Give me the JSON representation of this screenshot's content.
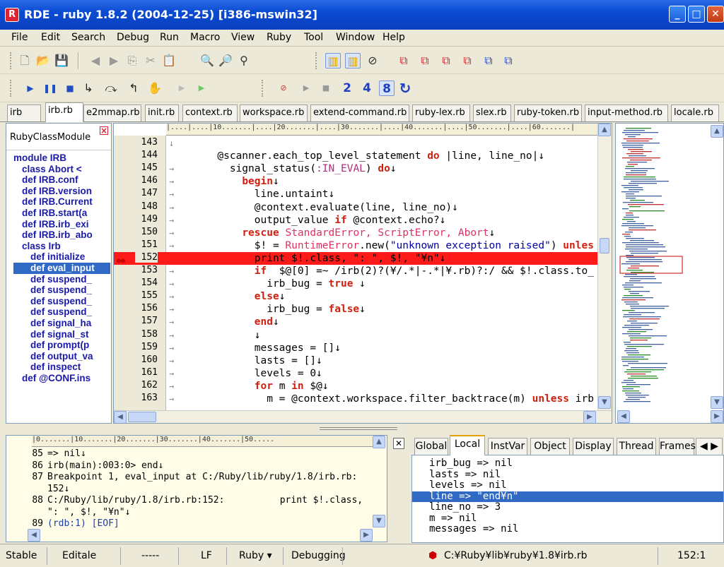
{
  "window": {
    "title": "RDE - ruby 1.8.2 (2004-12-25) [i386-mswin32]",
    "app_icon": "R"
  },
  "menu": [
    "File",
    "Edit",
    "Search",
    "Debug",
    "Run",
    "Macro",
    "View",
    "Ruby",
    "Tool",
    "Window",
    "Help"
  ],
  "toolbar2": {
    "speed_values": [
      "2",
      "4",
      "8"
    ]
  },
  "file_tabs": [
    "irb",
    "irb.rb",
    "e2mmap.rb",
    "init.rb",
    "context.rb",
    "workspace.rb",
    "extend-command.rb",
    "ruby-lex.rb",
    "slex.rb",
    "ruby-token.rb",
    "input-method.rb",
    "locale.rb"
  ],
  "left_panel": {
    "title": "RubyClassModule",
    "items": [
      {
        "text": "module IRB",
        "indent": 0
      },
      {
        "text": "class Abort <",
        "indent": 1
      },
      {
        "text": "def IRB.conf",
        "indent": 1
      },
      {
        "text": "def IRB.version",
        "indent": 1
      },
      {
        "text": "def IRB.Current",
        "indent": 1
      },
      {
        "text": "def IRB.start(a",
        "indent": 1
      },
      {
        "text": "def IRB.irb_exi",
        "indent": 1
      },
      {
        "text": "def IRB.irb_abo",
        "indent": 1
      },
      {
        "text": "class Irb",
        "indent": 1
      },
      {
        "text": "def initialize",
        "indent": 2
      },
      {
        "text": "def eval_input",
        "indent": 2,
        "selected": true
      },
      {
        "text": "def suspend_",
        "indent": 2
      },
      {
        "text": "def suspend_",
        "indent": 2
      },
      {
        "text": "def suspend_",
        "indent": 2
      },
      {
        "text": "def suspend_",
        "indent": 2
      },
      {
        "text": "def signal_ha",
        "indent": 2
      },
      {
        "text": "def signal_st",
        "indent": 2
      },
      {
        "text": "def prompt(p",
        "indent": 2
      },
      {
        "text": "def output_va",
        "indent": 2
      },
      {
        "text": "def inspect",
        "indent": 2
      },
      {
        "text": "def @CONF.ins",
        "indent": 1
      }
    ]
  },
  "editor": {
    "ruler": "|....|....|10.......|....|20.......|....|30.......|....|40.......|....|50.......|....|60.......|",
    "lines": [
      {
        "n": "143",
        "arrow": "↓",
        "html": ""
      },
      {
        "n": "144",
        "arrow": "",
        "html": "      @scanner.each_top_level_statement <span class=\"kw\">do</span> |line, line_no|↓"
      },
      {
        "n": "145",
        "arrow": "→",
        "html": "        signal_status(<span class=\"sy\">:IN_EVAL</span>) <span class=\"kw\">do</span>↓"
      },
      {
        "n": "146",
        "arrow": "→",
        "html": "          <span class=\"kw\">begin</span>↓"
      },
      {
        "n": "147",
        "arrow": "→",
        "html": "            line.untaint↓"
      },
      {
        "n": "148",
        "arrow": "→",
        "html": "            @context.evaluate(line, line_no)↓"
      },
      {
        "n": "149",
        "arrow": "→",
        "html": "            output_value <span class=\"kw\">if</span> @context.echo?↓"
      },
      {
        "n": "150",
        "arrow": "→",
        "html": "          <span class=\"kw\">rescue</span> <span class=\"cl\">StandardError, ScriptError, Abort</span>↓"
      },
      {
        "n": "151",
        "arrow": "→",
        "html": "            $! = <span class=\"cl\">RuntimeError</span>.new(<span class=\"st\">\"unknown exception raised\"</span>) <span class=\"kw\">unles</span>"
      },
      {
        "n": "152",
        "arrow": "",
        "html": "            print $!.class, \": \", $!, \"¥n\"↓",
        "bp": true
      },
      {
        "n": "153",
        "arrow": "→",
        "html": "            <span class=\"kw\">if</span>  $@[0] =~ /irb(2)?(¥/.*|-.*|¥.rb)?:/ &amp;&amp; $!.class.to_"
      },
      {
        "n": "154",
        "arrow": "→",
        "html": "              irb_bug = <span class=\"kw\">true</span> ↓"
      },
      {
        "n": "155",
        "arrow": "→",
        "html": "            <span class=\"kw\">else</span>↓"
      },
      {
        "n": "156",
        "arrow": "→",
        "html": "              irb_bug = <span class=\"kw\">false</span>↓"
      },
      {
        "n": "157",
        "arrow": "→",
        "html": "            <span class=\"kw\">end</span>↓"
      },
      {
        "n": "158",
        "arrow": "→",
        "html": "            ↓"
      },
      {
        "n": "159",
        "arrow": "→",
        "html": "            messages = []↓"
      },
      {
        "n": "160",
        "arrow": "→",
        "html": "            lasts = []↓"
      },
      {
        "n": "161",
        "arrow": "→",
        "html": "            levels = 0↓"
      },
      {
        "n": "162",
        "arrow": "→",
        "html": "            <span class=\"kw\">for</span> m <span class=\"kw\">in</span> $@↓"
      },
      {
        "n": "163",
        "arrow": "→",
        "html": "              m = @context.workspace.filter_backtrace(m) <span class=\"kw\">unless</span> irb"
      }
    ]
  },
  "console": {
    "ruler": "|0.......|10.......|20.......|30.......|40.......|50.....",
    "lines": [
      {
        "n": "85",
        "t": "=> nil↓"
      },
      {
        "n": "86",
        "t": "irb(main):003:0> end↓"
      },
      {
        "n": "87",
        "t": "Breakpoint 1, eval_input at C:/Ruby/lib/ruby/1.8/irb.rb:"
      },
      {
        "n": "",
        "t": "152↓"
      },
      {
        "n": "88",
        "t": "C:/Ruby/lib/ruby/1.8/irb.rb:152:          print $!.class,"
      },
      {
        "n": "",
        "t": "\": \", $!, \"¥n\"↓"
      },
      {
        "n": "89",
        "t": "(rdb:1) [EOF]"
      }
    ]
  },
  "var_tabs": [
    "Global",
    "Local",
    "InstVar",
    "Object",
    "Display",
    "Thread",
    "Frames"
  ],
  "variables": [
    {
      "t": "irb_bug => nil"
    },
    {
      "t": "lasts => nil"
    },
    {
      "t": "levels => nil"
    },
    {
      "t": "line => \"end¥n\"",
      "selected": true
    },
    {
      "t": "line_no => 3"
    },
    {
      "t": "m => nil"
    },
    {
      "t": "messages => nil"
    }
  ],
  "status": {
    "mode": "Stable",
    "edit": "Editale",
    "dashes": "-----",
    "eol": "LF",
    "lang": "Ruby ▾",
    "state": "Debugging",
    "path": "C:¥Ruby¥lib¥ruby¥1.8¥irb.rb",
    "pos": "152:1"
  }
}
